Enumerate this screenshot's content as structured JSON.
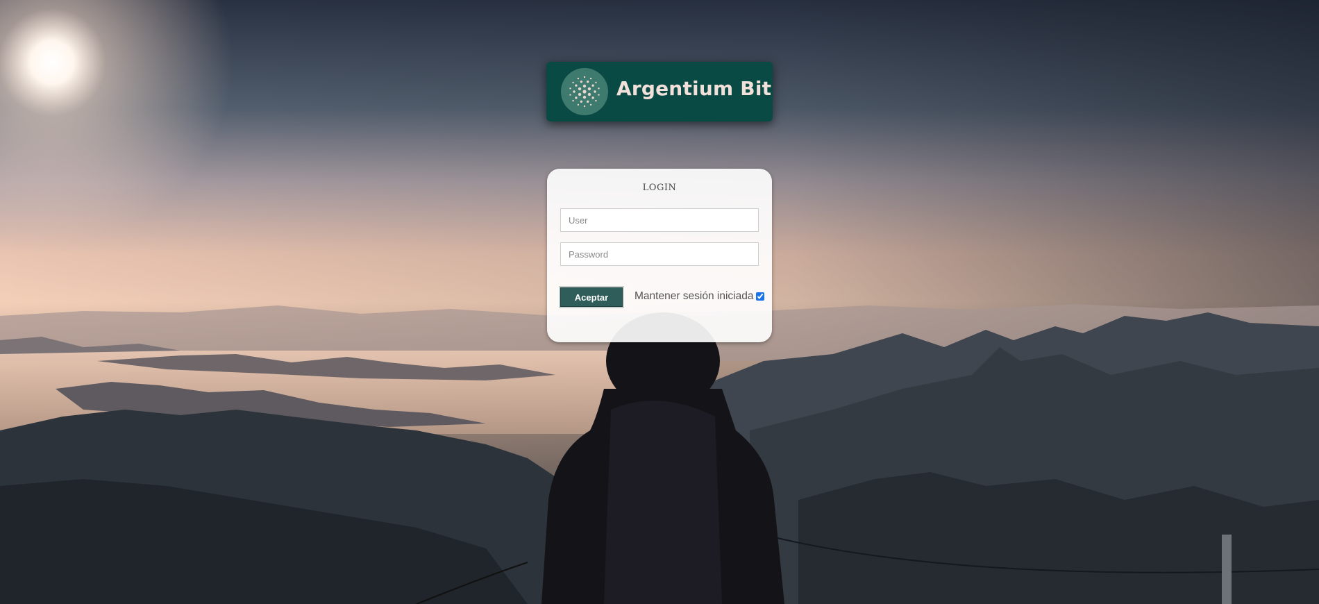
{
  "brand": {
    "name": "Argentium Bit",
    "logo_icon": "argentium-dots-icon",
    "logo_background": "#0a4a44",
    "logo_text_color": "#f2e1da"
  },
  "login": {
    "title": "LOGIN",
    "user_placeholder": "User",
    "user_value": "",
    "password_placeholder": "Password",
    "password_value": "",
    "submit_label": "Aceptar",
    "submit_color": "#2f5e5a",
    "remember_label": "Mantener sesión iniciada",
    "remember_checked": true
  },
  "background": {
    "description_icon": "mountain-sunset-photo"
  }
}
